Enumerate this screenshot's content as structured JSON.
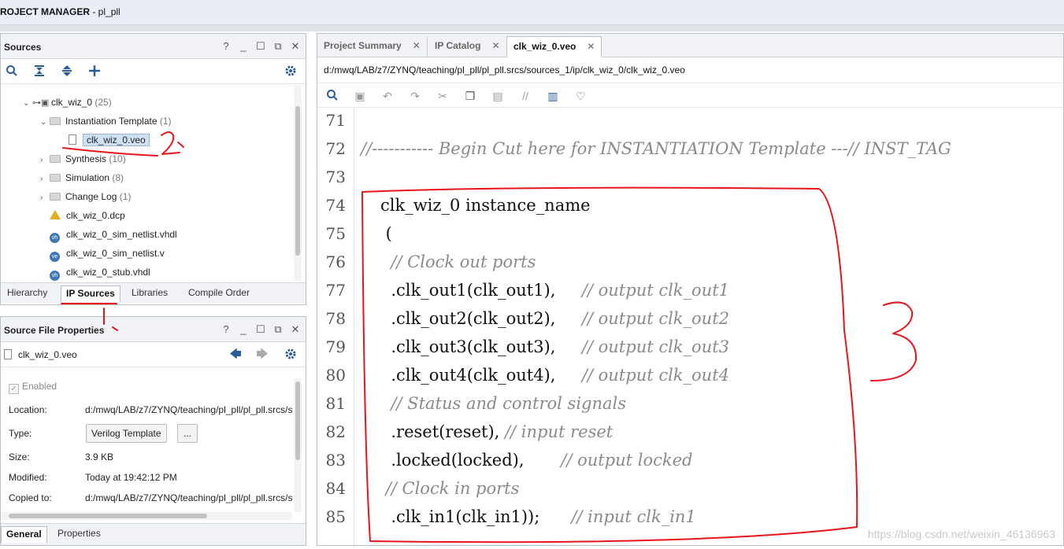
{
  "window": {
    "title_prefix": "ROJECT MANAGER",
    "title_suffix": " - pl_pll"
  },
  "sources": {
    "title": "Sources",
    "win_buttons": [
      "?",
      "_",
      "☐",
      "⧉",
      "✕"
    ],
    "tree": {
      "ip_name": "clk_wiz_0",
      "ip_count": "(25)",
      "inst_template": "Instantiation Template",
      "inst_count": "(1)",
      "veo_file": "clk_wiz_0.veo",
      "synthesis": "Synthesis",
      "synthesis_count": "(10)",
      "simulation": "Simulation",
      "simulation_count": "(8)",
      "changelog": "Change Log",
      "changelog_count": "(1)",
      "dcp": "clk_wiz_0.dcp",
      "sim_vhdl": "clk_wiz_0_sim_netlist.vhdl",
      "sim_v": "clk_wiz_0_sim_netlist.v",
      "stub_vhdl": "clk_wiz_0_stub.vhdl"
    },
    "tabs": [
      "Hierarchy",
      "IP Sources",
      "Libraries",
      "Compile Order"
    ]
  },
  "properties": {
    "title": "Source File Properties",
    "file": "clk_wiz_0.veo",
    "enabled": "Enabled",
    "location_label": "Location:",
    "location_value": "d:/mwq/LAB/z7/ZYNQ/teaching/pl_pll/pl_pll.srcs/s",
    "type_label": "Type:",
    "type_value": "Verilog Template",
    "type_more": "...",
    "size_label": "Size:",
    "size_value": "3.9 KB",
    "modified_label": "Modified:",
    "modified_value": "Today at 19:42:12 PM",
    "copied_label": "Copied to:",
    "copied_value": "d:/mwq/LAB/z7/ZYNQ/teaching/pl_pll/pl_pll.srcs/s",
    "tabs": [
      "General",
      "Properties"
    ]
  },
  "editor": {
    "tabs": [
      "Project Summary",
      "IP Catalog",
      "clk_wiz_0.veo"
    ],
    "path": "d:/mwq/LAB/z7/ZYNQ/teaching/pl_pll/pl_pll.srcs/sources_1/ip/clk_wiz_0/clk_wiz_0.veo",
    "lines": [
      {
        "n": "71",
        "code": "",
        "comment": ""
      },
      {
        "n": "72",
        "code": "",
        "comment": "//----------- Begin Cut here for INSTANTIATION Template ---// INST_TAG"
      },
      {
        "n": "73",
        "code": "",
        "comment": ""
      },
      {
        "n": "74",
        "code": "clk_wiz_0 instance_name",
        "comment": ""
      },
      {
        "n": "75",
        "code": " (",
        "comment": ""
      },
      {
        "n": "76",
        "code": "  ",
        "comment": "// Clock out ports"
      },
      {
        "n": "77",
        "code": "  .clk_out1(clk_out1),     ",
        "comment": "// output clk_out1"
      },
      {
        "n": "78",
        "code": "  .clk_out2(clk_out2),     ",
        "comment": "// output clk_out2"
      },
      {
        "n": "79",
        "code": "  .clk_out3(clk_out3),     ",
        "comment": "// output clk_out3"
      },
      {
        "n": "80",
        "code": "  .clk_out4(clk_out4),     ",
        "comment": "// output clk_out4"
      },
      {
        "n": "81",
        "code": "  ",
        "comment": "// Status and control signals"
      },
      {
        "n": "82",
        "code": "  .reset(reset), ",
        "comment": "// input reset"
      },
      {
        "n": "83",
        "code": "  .locked(locked),       ",
        "comment": "// output locked"
      },
      {
        "n": "84",
        "code": " ",
        "comment": "// Clock in ports"
      },
      {
        "n": "85",
        "code": "  .clk_in1(clk_in1));      ",
        "comment": "// input clk_in1"
      }
    ]
  },
  "watermark": "https://blog.csdn.net/weixin_46136963",
  "annotations": {
    "mark_2": "2",
    "mark_3": "3",
    "color": "#e8141b"
  }
}
